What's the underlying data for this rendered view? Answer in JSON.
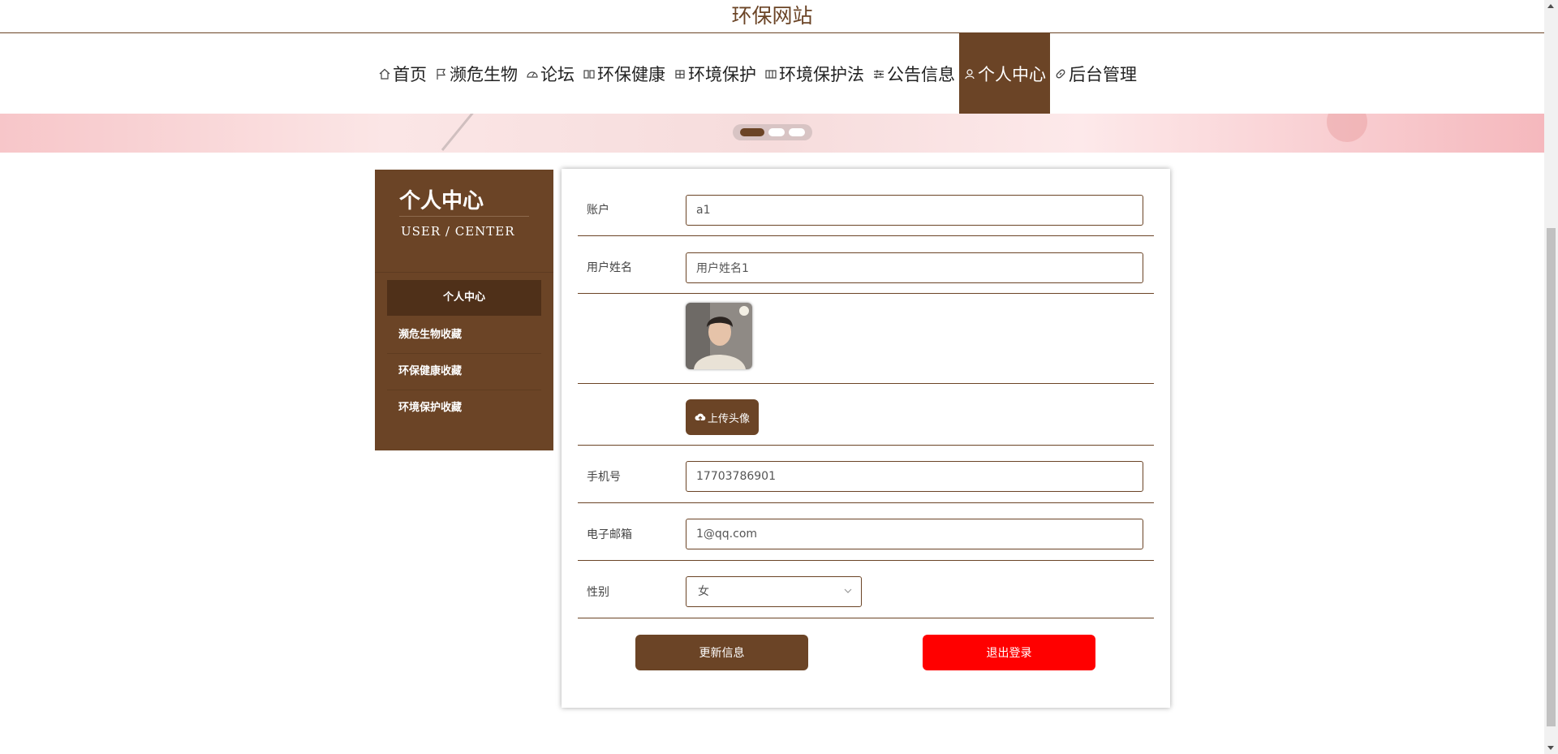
{
  "site": {
    "title": "环保网站"
  },
  "nav": {
    "items": [
      {
        "label": "首页",
        "icon": "home-icon"
      },
      {
        "label": "濒危生物",
        "icon": "flag-icon"
      },
      {
        "label": "论坛",
        "icon": "dashboard-icon"
      },
      {
        "label": "环保健康",
        "icon": "book-icon"
      },
      {
        "label": "环境保护",
        "icon": "grid-icon"
      },
      {
        "label": "环境保护法",
        "icon": "columns-icon"
      },
      {
        "label": "公告信息",
        "icon": "sliders-icon"
      },
      {
        "label": "个人中心",
        "icon": "user-icon",
        "active": true
      },
      {
        "label": "后台管理",
        "icon": "link-icon"
      }
    ],
    "active_color": "#6b4426"
  },
  "banner": {
    "slides": 3,
    "active_slide": 1
  },
  "sidebar": {
    "title": "个人中心",
    "subtitle": "USER / CENTER",
    "menu": [
      {
        "label": "个人中心",
        "active": true
      },
      {
        "label": "濒危生物收藏"
      },
      {
        "label": "环保健康收藏"
      },
      {
        "label": "环境保护收藏"
      }
    ]
  },
  "form": {
    "account": {
      "label": "账户",
      "value": "a1"
    },
    "username": {
      "label": "用户姓名",
      "value": "用户姓名1"
    },
    "upload_label": "上传头像",
    "phone": {
      "label": "手机号",
      "value": "17703786901"
    },
    "email": {
      "label": "电子邮箱",
      "value": "1@qq.com"
    },
    "gender": {
      "label": "性别",
      "value": "女"
    },
    "update_label": "更新信息",
    "logout_label": "退出登录"
  },
  "colors": {
    "brand": "#6b4426",
    "danger": "#ff0000"
  }
}
